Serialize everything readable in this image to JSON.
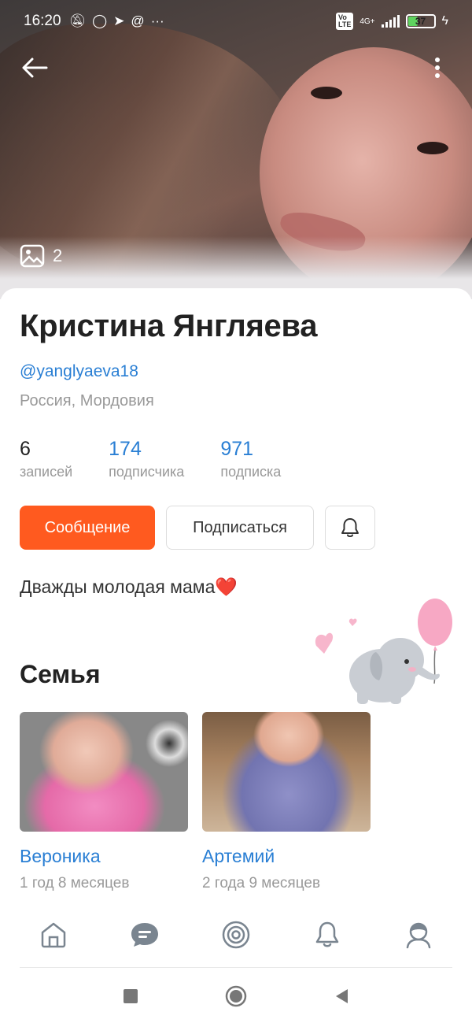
{
  "status_bar": {
    "time": "16:20",
    "network": "4G+",
    "battery": "37"
  },
  "cover": {
    "photo_count": "2"
  },
  "profile": {
    "name": "Кристина Янгляева",
    "handle": "@yanglyaeva18",
    "location": "Россия, Мордовия",
    "bio": "Дважды молодая мама❤️"
  },
  "stats": [
    {
      "value": "6",
      "label": "записей"
    },
    {
      "value": "174",
      "label": "подписчика"
    },
    {
      "value": "971",
      "label": "подписка"
    }
  ],
  "actions": {
    "message_label": "Сообщение",
    "subscribe_label": "Подписаться"
  },
  "family": {
    "title": "Семья",
    "members": [
      {
        "name": "Вероника",
        "age": "1 год 8 месяцев"
      },
      {
        "name": "Артемий",
        "age": "2 года 9 месяцев"
      }
    ]
  },
  "colors": {
    "accent": "#ff5a1f",
    "link": "#2a7fd4",
    "muted": "#999999"
  },
  "nav": [
    "home-icon",
    "messages-icon",
    "discover-icon",
    "notifications-icon",
    "profile-icon"
  ]
}
